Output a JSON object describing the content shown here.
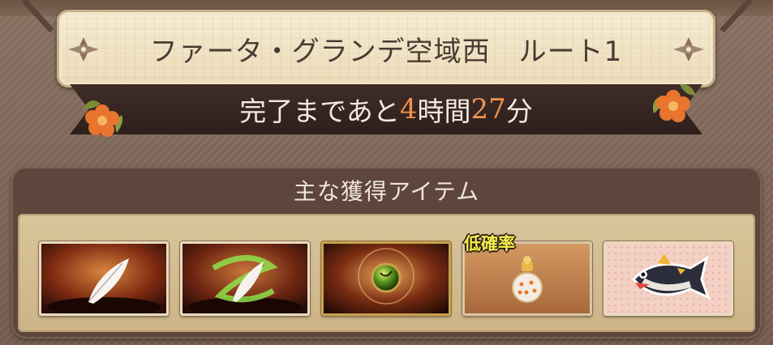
{
  "route": {
    "title": "ファータ・グランデ空域西　ルート1"
  },
  "timer": {
    "prefix": "完了まであと",
    "hours": "4",
    "hours_unit": "時間",
    "minutes": "27",
    "minutes_unit": "分"
  },
  "items_panel": {
    "header": "主な獲得アイテム",
    "rarity_badge": "低確率",
    "items": [
      {
        "icon": "white-feather-icon"
      },
      {
        "icon": "green-wind-feather-icon"
      },
      {
        "icon": "green-orb-icon"
      },
      {
        "icon": "perfume-bottle-icon"
      },
      {
        "icon": "tuna-fish-icon"
      }
    ]
  },
  "colors": {
    "number_accent": "#f1934d",
    "rarity_text": "#f7ee4a",
    "ribbon_bg": "#2d1f1b",
    "plaque_bg": "#f6ecd3"
  }
}
